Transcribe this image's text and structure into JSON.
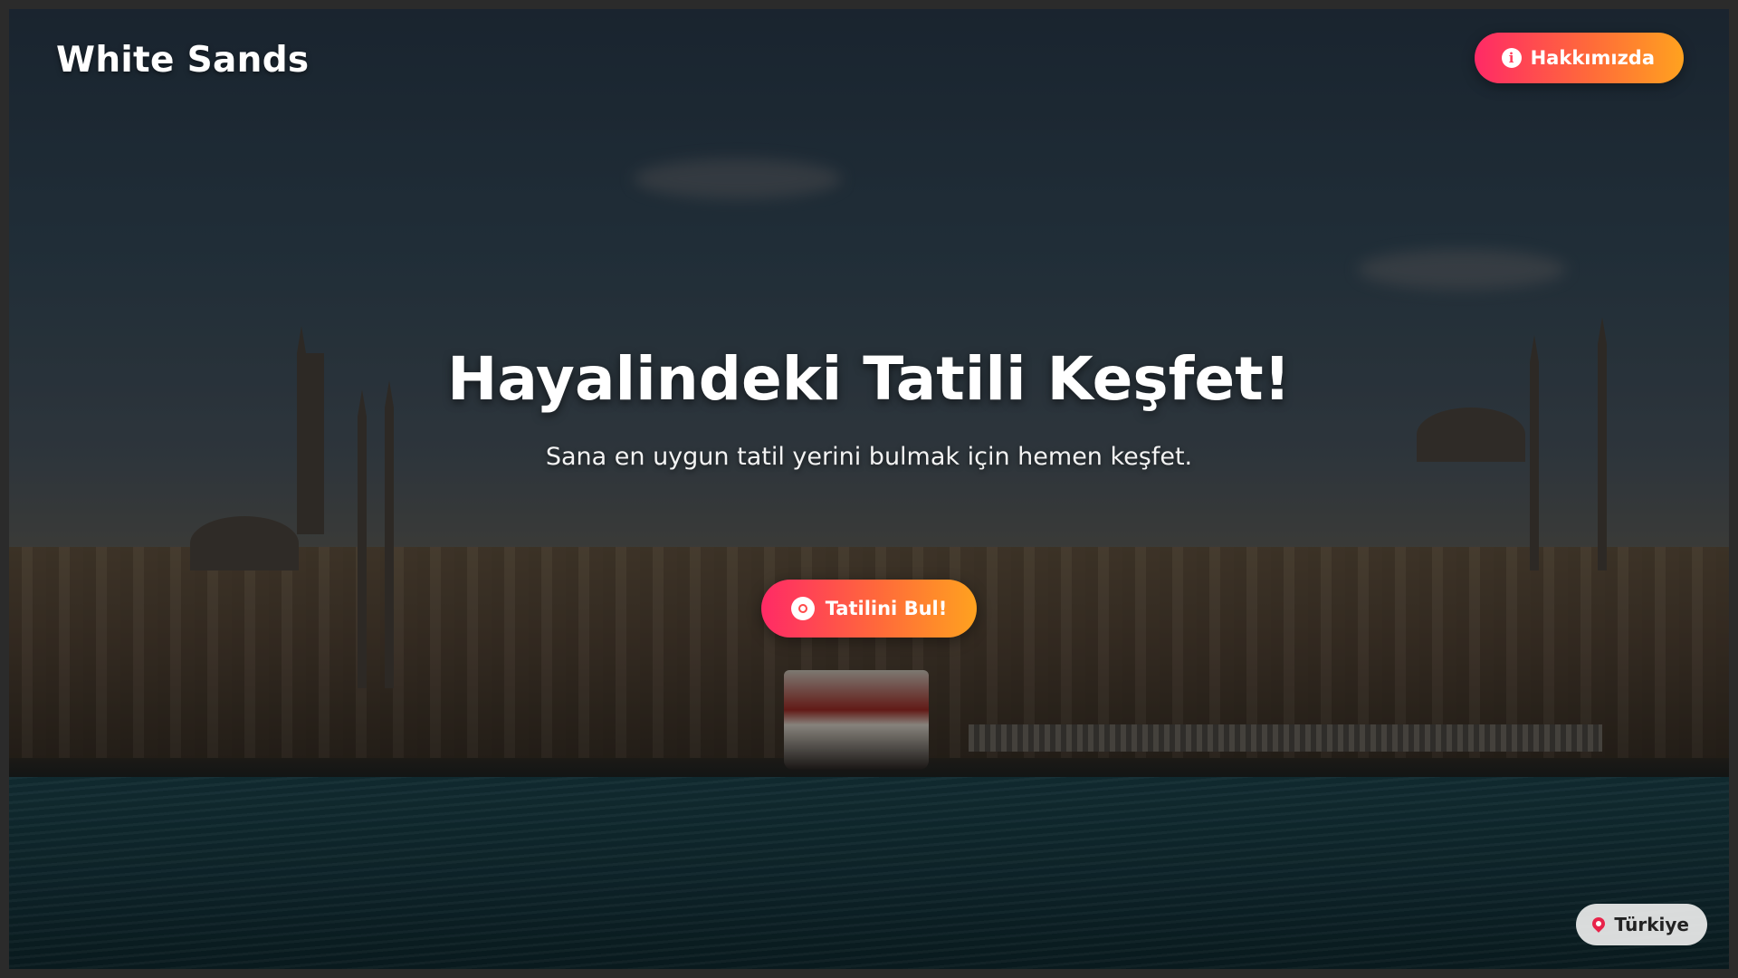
{
  "header": {
    "brand": "White Sands",
    "about_button": {
      "label": "Hakkımızda",
      "icon": "info-icon"
    }
  },
  "hero": {
    "title": "Hayalindeki Tatili Keşfet!",
    "subtitle": "Sana en uygun tatil yerini bulmak için hemen keşfet.",
    "cta_button": {
      "label": "Tatilini Bul!",
      "icon": "compass-icon"
    }
  },
  "location_badge": {
    "label": "Türkiye",
    "icon": "map-pin-icon"
  },
  "colors": {
    "accent_gradient_start": "#ff2a66",
    "accent_gradient_end": "#ffa21f",
    "pin": "#e8234a"
  }
}
